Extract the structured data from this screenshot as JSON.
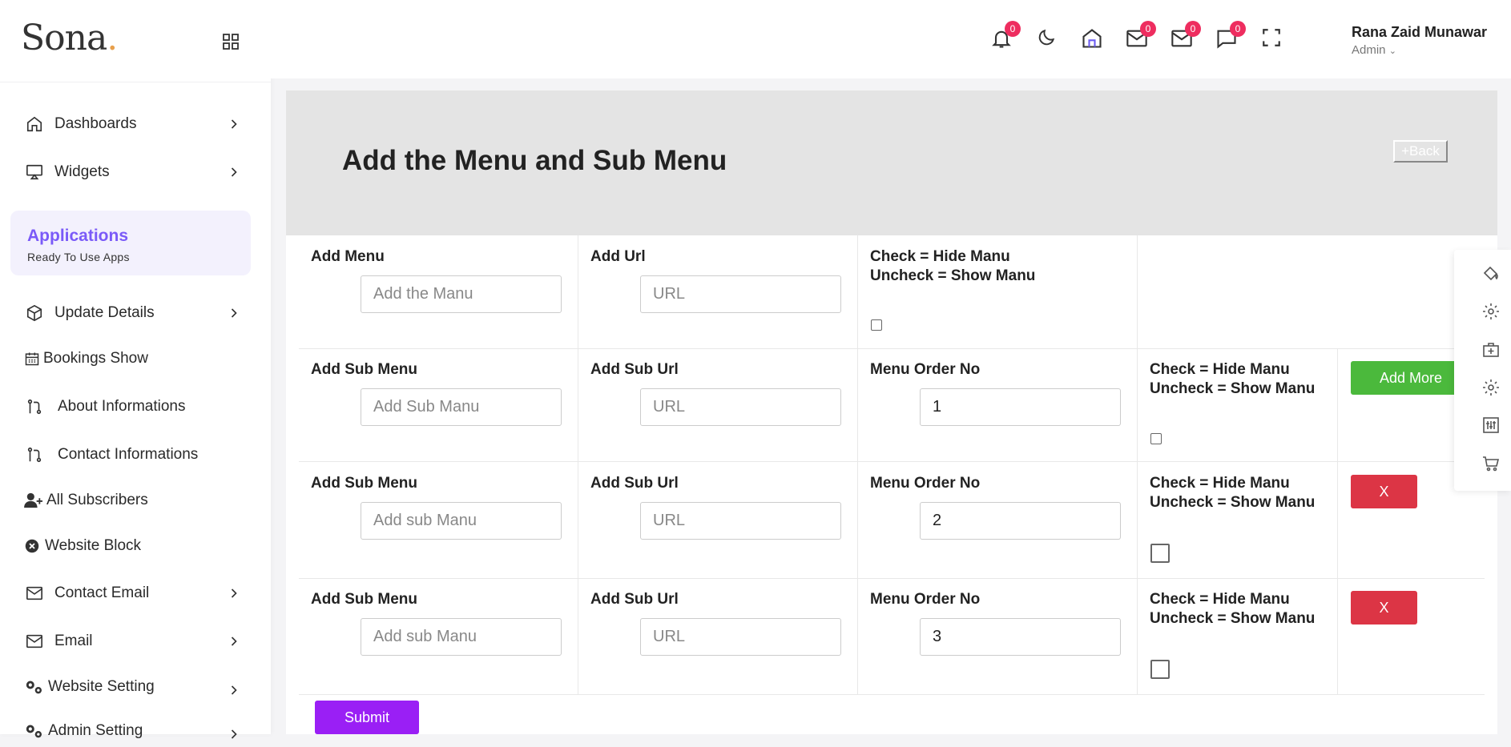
{
  "brand": {
    "name": "Sona",
    "dot": "."
  },
  "sidebar": {
    "items": [
      {
        "label": "Dashboards",
        "icon": "home-icon",
        "has_chevron": true
      },
      {
        "label": "Widgets",
        "icon": "airplay-icon",
        "has_chevron": true
      },
      {
        "label": "Update Details",
        "icon": "box-icon",
        "has_chevron": true
      },
      {
        "label": "Bookings Show",
        "icon": "calendar-icon",
        "has_chevron": false
      },
      {
        "label": "About Informations",
        "icon": "git-pull-icon",
        "has_chevron": false
      },
      {
        "label": "Contact Informations",
        "icon": "git-pull-icon",
        "has_chevron": false
      },
      {
        "label": "All Subscribers",
        "icon": "user-plus-icon",
        "has_chevron": false
      },
      {
        "label": "Website Block",
        "icon": "block-icon",
        "has_chevron": false
      },
      {
        "label": "Contact Email",
        "icon": "mail-icon",
        "has_chevron": true
      },
      {
        "label": "Email",
        "icon": "mail-icon",
        "has_chevron": true
      },
      {
        "label": "Website Setting",
        "icon": "gears-icon",
        "has_chevron": true
      },
      {
        "label": "Admin Setting",
        "icon": "gears-icon",
        "has_chevron": true
      }
    ],
    "applications": {
      "title": "Applications",
      "subtitle": "Ready To Use Apps"
    }
  },
  "topbar": {
    "badges": {
      "notifications": "0",
      "mail1": "0",
      "mail2": "0",
      "chat": "0"
    },
    "user": {
      "name": "Rana Zaid Munawar",
      "role": "Admin"
    }
  },
  "page": {
    "title": "Add the Menu and Sub Menu",
    "back_label": "+Back"
  },
  "form": {
    "menu": {
      "menu_label": "Add Menu",
      "menu_placeholder": "Add the Manu",
      "url_label": "Add Url",
      "url_placeholder": "URL",
      "check_label_1": "Check = Hide Manu",
      "check_label_2": "Uncheck = Show Manu"
    },
    "sub_rows": [
      {
        "sub_label": "Add Sub Menu",
        "sub_placeholder": "Add Sub Manu",
        "url_label": "Add Sub Url",
        "url_placeholder": "URL",
        "order_label": "Menu Order No",
        "order_value": "1",
        "check_label_1": "Check = Hide Manu",
        "check_label_2": "Uncheck = Show Manu",
        "action": "Add More"
      },
      {
        "sub_label": "Add Sub Menu",
        "sub_placeholder": "Add sub Manu",
        "url_label": "Add Sub Url",
        "url_placeholder": "URL",
        "order_label": "Menu Order No",
        "order_value": "2",
        "check_label_1": "Check = Hide Manu",
        "check_label_2": "Uncheck = Show Manu",
        "action": "X"
      },
      {
        "sub_label": "Add Sub Menu",
        "sub_placeholder": "Add sub Manu",
        "url_label": "Add Sub Url",
        "url_placeholder": "URL",
        "order_label": "Menu Order No",
        "order_value": "3",
        "check_label_1": "Check = Hide Manu",
        "check_label_2": "Uncheck = Show Manu",
        "action": "X"
      }
    ],
    "submit_label": "Submit"
  },
  "colors": {
    "accent": "#7a5af8",
    "badge": "#ee2d5f",
    "add_more": "#4bb93c",
    "remove": "#dc3545",
    "submit": "#9a1ff5"
  }
}
